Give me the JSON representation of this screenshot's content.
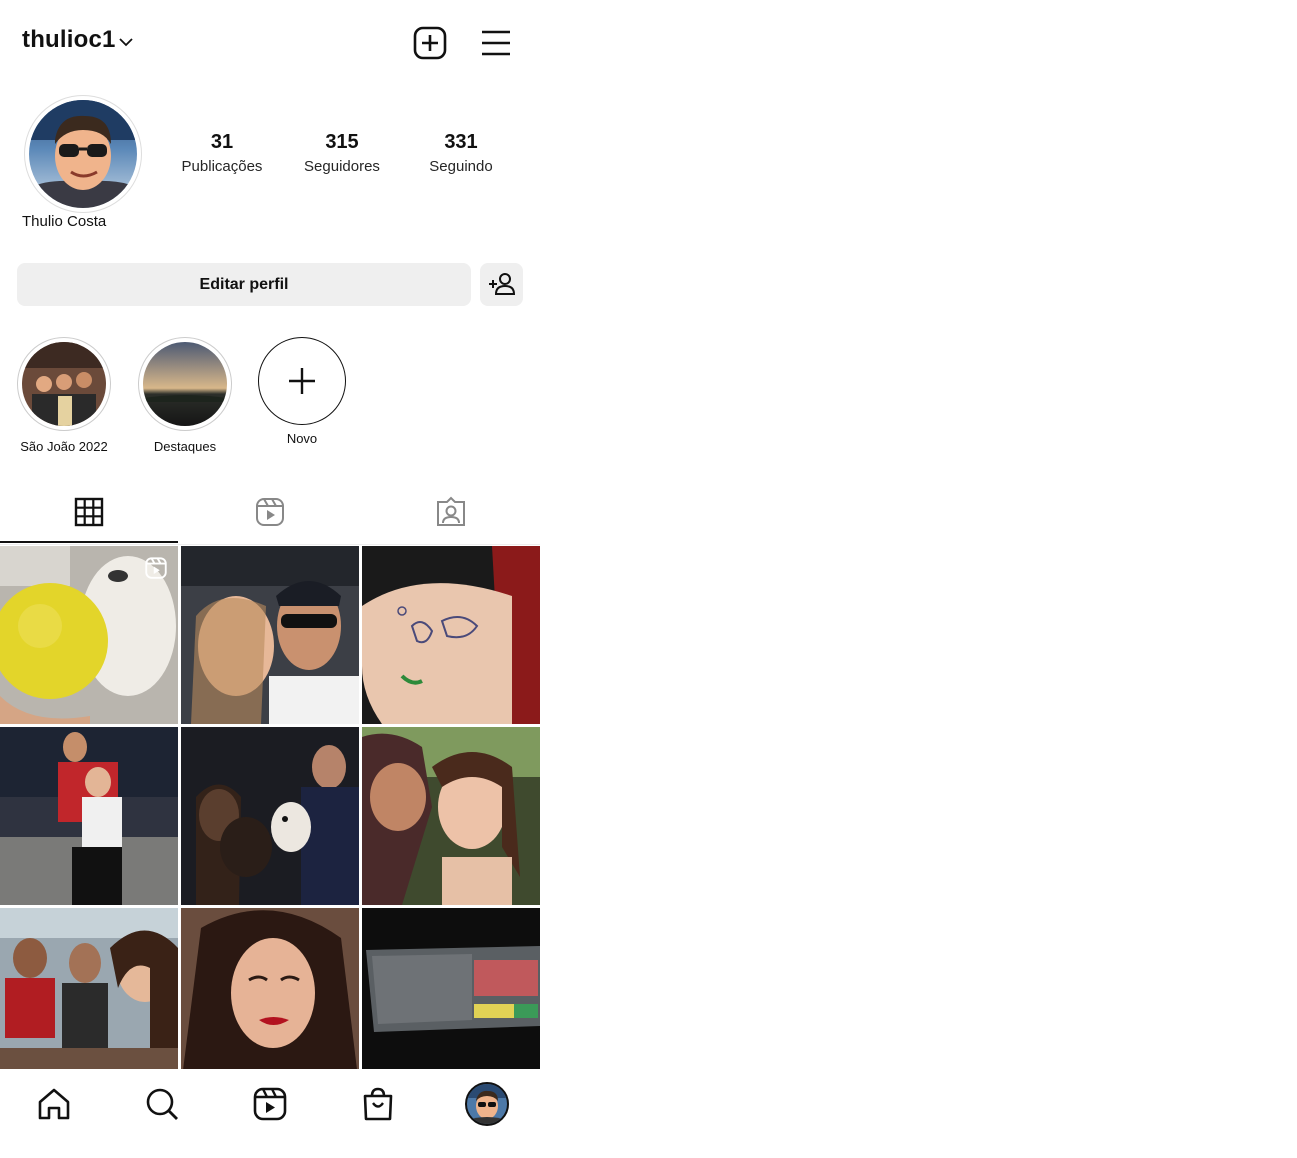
{
  "header": {
    "username": "thulioc1",
    "icons": {
      "account_switch": "chevron-down-icon",
      "create": "plus-square-icon",
      "menu": "hamburger-menu-icon"
    }
  },
  "profile": {
    "display_name": "Thulio Costa",
    "stats": [
      {
        "value": "31",
        "label": "Publicações"
      },
      {
        "value": "315",
        "label": "Seguidores"
      },
      {
        "value": "331",
        "label": "Seguindo"
      }
    ],
    "edit_label": "Editar perfil",
    "discover_icon": "add-person-icon"
  },
  "highlights": [
    {
      "label": "São João 2022"
    },
    {
      "label": "Destaques"
    },
    {
      "label": "Novo"
    }
  ],
  "tabs": [
    "grid-icon",
    "reels-icon",
    "tagged-icon"
  ],
  "grid": {
    "posts": [
      {
        "kind": "reel",
        "theme": "dog with yellow ball"
      },
      {
        "kind": "photo",
        "theme": "selfie couple in car"
      },
      {
        "kind": "photo",
        "theme": "arm tattoo"
      },
      {
        "kind": "photo",
        "theme": "couple at night rooftop"
      },
      {
        "kind": "photo",
        "theme": "couple with dogs"
      },
      {
        "kind": "photo",
        "theme": "couple kiss selfie"
      },
      {
        "kind": "photo",
        "theme": "group of friends"
      },
      {
        "kind": "photo",
        "theme": "woman selfie"
      },
      {
        "kind": "photo",
        "theme": "computer screen"
      }
    ]
  },
  "bottom_nav": [
    "home-icon",
    "search-icon",
    "reels-icon",
    "shop-icon",
    "profile-avatar"
  ],
  "colors": {
    "text": "#111111",
    "button_bg": "#efefef",
    "divider": "#eeeeee"
  }
}
